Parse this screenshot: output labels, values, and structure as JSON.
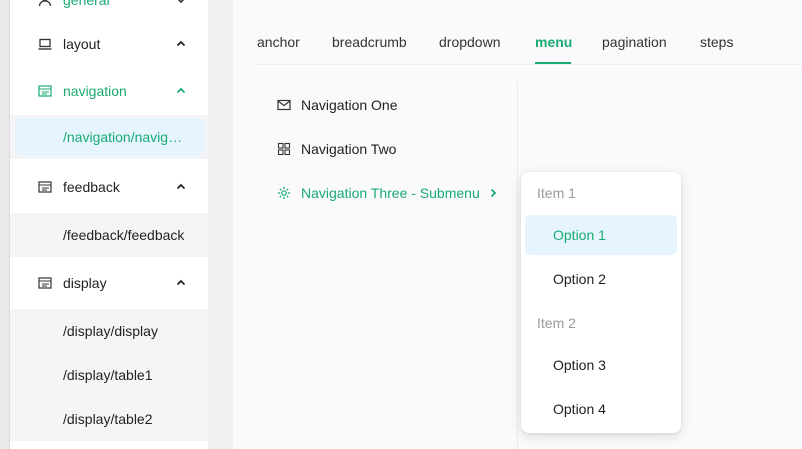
{
  "sidebar": {
    "items": [
      {
        "label": "general",
        "icon": "user-icon"
      },
      {
        "label": "layout",
        "icon": "laptop-icon"
      },
      {
        "label": "navigation",
        "icon": "layout-list-icon"
      },
      {
        "label": "feedback",
        "icon": "layout-list-icon"
      },
      {
        "label": "display",
        "icon": "layout-list-icon"
      }
    ],
    "subitems": {
      "navigation": "/navigation/navigation",
      "feedback": "/feedback/feedback",
      "display": [
        "/display/display",
        "/display/table1",
        "/display/table2"
      ]
    }
  },
  "tabs": [
    "anchor",
    "breadcrumb",
    "dropdown",
    "menu",
    "pagination",
    "steps"
  ],
  "active_tab": "menu",
  "menu": {
    "items": [
      {
        "label": "Navigation One",
        "icon": "mail-icon"
      },
      {
        "label": "Navigation Two",
        "icon": "appstore-icon"
      },
      {
        "label": "Navigation Three - Submenu",
        "icon": "setting-icon"
      }
    ]
  },
  "submenu": {
    "groups": [
      {
        "title": "Item 1",
        "options": [
          "Option 1",
          "Option 2"
        ]
      },
      {
        "title": "Item 2",
        "options": [
          "Option 3",
          "Option 4"
        ]
      }
    ],
    "selected": "Option 1"
  },
  "colors": {
    "accent": "#1aab73",
    "selected_bg": "#e6f4fd"
  }
}
